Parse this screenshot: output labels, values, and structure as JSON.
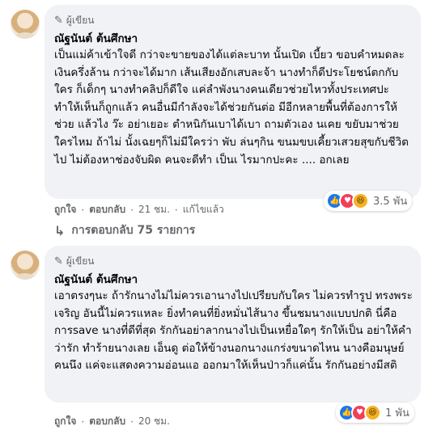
{
  "comments": [
    {
      "badge": "ผู้เขียน",
      "author": "ณัฐนันต์ ต้นศึกษา",
      "text": "เป็นแม่ค้าเข้าใจดี กว่าจะขายของได้แต่ละบาท นั้นเปิด เบี้ยว ขอบคำหมดละ เงินครึ่งล้าน กว่าจะได้มาก เส้นเสียงอักเสบละจ้า นางทำก็ดีประโยชน์ตกกับใคร ก็เด็กๆ นางทำคลิปก็ดีใจ แค่ลำพังนางคนเดียวช่วยไหวทั้งประเทศปะ ทำให้เห็นก็ถูกแล้ว คนอื่นมีกำลังจะได้ช่วยกันต่อ มีอีกหลายพื้นที่ต้องการให้ช่วย แล้วไง ว๊ะ อย่าเยอะ ตำหนิกันเบาได้เบา ถามตัวเอง นเคย ขยับมาช่วยใครไหม ถ้าไม่ นั้งเฉยๆก็ไม่มีใครว่า พับ ล่นๆกิน ขนมขบเคี้ยวเสวยสุขกับชีวิต ไป ไม่ต้องหาช่องจับผิด คนจะดีทำ เป็นเ ไรมากปะคะ .... อกเลย",
      "reaction_count": "3.5 พัน",
      "actions": {
        "like": "ถูกใจ",
        "reply": "ตอบกลับ",
        "time": "21 ชม.",
        "edited": "แก้ไขแล้ว"
      },
      "replies_label": "การตอบกลับ 75 รายการ"
    },
    {
      "badge": "ผู้เขียน",
      "author": "ณัฐนันต์ ต้นศึกษา",
      "text": "เอาตรงๆนะ ถ้ารักนางไม่ไม่ควรเอานางไปเปรียบกับใคร ไม่ควรทำรูป ทรงพระเจริญ อันนี้ไม่ควรแหละ ยิ่งทำคนที่ยิ่งหมั่นไส้นาง ขึ้นชมนางแบบปกติ นี่คือการsave นางที่ดีที่สุด รักกันอย่าลากนางไปเป็นเหยื่อใดๆ รักให้เป็น อย่าให้คำว่ารัก ทำร้ายนางเลย เอ็นดู ต่อให้ข้างนอกนางแกร่งขนาดไหน นางคือมนุษย์คนนึง แค่จะแสดงความอ่อนแอ ออกมาให้เห็นป่าวก็แค่นั้น รักกันอย่างมีสติ",
      "reaction_count": "1 พัน",
      "actions": {
        "like": "ถูกใจ",
        "reply": "ตอบกลับ",
        "time": "20 ชม."
      }
    }
  ],
  "colors": {
    "bubble": "#f0f2f5",
    "meta": "#65676b",
    "like": "#1877f2",
    "love": "#f33e58",
    "haha": "#f7b125"
  },
  "icons": [
    "pen-icon",
    "like-reaction-icon",
    "love-reaction-icon",
    "haha-reaction-icon",
    "reply-arrow-icon"
  ]
}
